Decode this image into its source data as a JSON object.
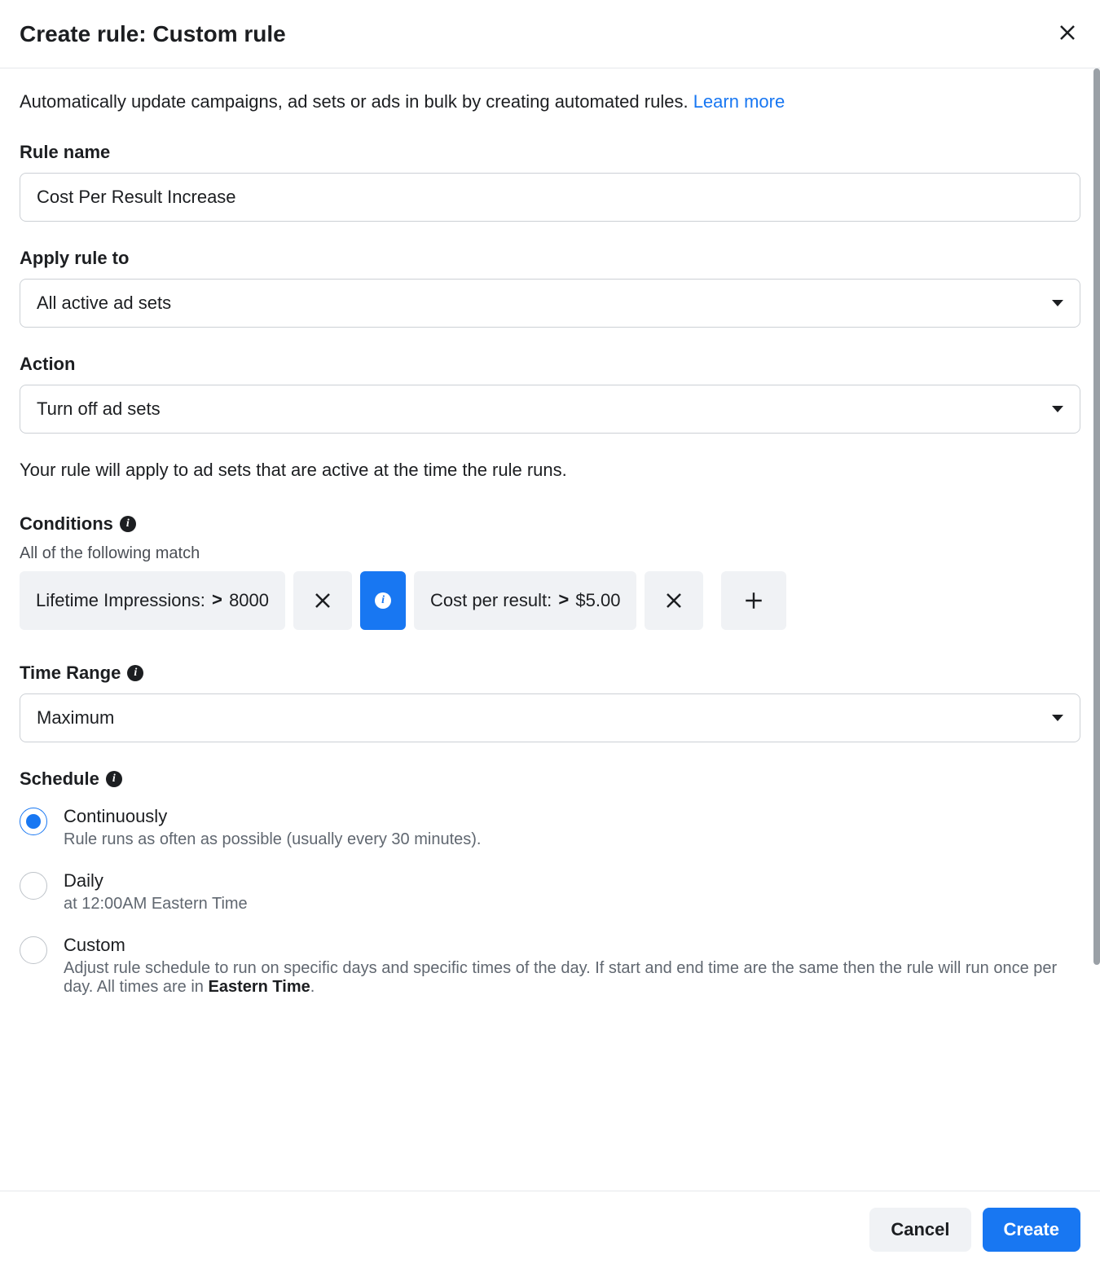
{
  "header": {
    "title": "Create rule: Custom rule"
  },
  "intro": {
    "text": "Automatically update campaigns, ad sets or ads in bulk by creating automated rules. ",
    "link": "Learn more"
  },
  "rule_name": {
    "label": "Rule name",
    "value": "Cost Per Result Increase"
  },
  "apply_to": {
    "label": "Apply rule to",
    "value": "All active ad sets"
  },
  "action": {
    "label": "Action",
    "value": "Turn off ad sets"
  },
  "note": "Your rule will apply to ad sets that are active at the time the rule runs.",
  "conditions": {
    "label": "Conditions",
    "subtext": "All of the following match",
    "items": [
      {
        "metric": "Lifetime Impressions:",
        "op": ">",
        "value": "8000",
        "has_info": true
      },
      {
        "metric": "Cost per result:",
        "op": ">",
        "value": "$5.00",
        "has_info": false
      }
    ]
  },
  "time_range": {
    "label": "Time Range",
    "value": "Maximum"
  },
  "schedule": {
    "label": "Schedule",
    "options": [
      {
        "title": "Continuously",
        "desc": "Rule runs as often as possible (usually every 30 minutes).",
        "checked": true
      },
      {
        "title": "Daily",
        "desc": "at 12:00AM Eastern Time",
        "checked": false
      },
      {
        "title": "Custom",
        "desc_pre": "Adjust rule schedule to run on specific days and specific times of the day. If start and end time are the same then the rule will run once per day. All times are in ",
        "desc_bold": "Eastern Time",
        "desc_post": ".",
        "checked": false
      }
    ]
  },
  "footer": {
    "cancel": "Cancel",
    "create": "Create"
  }
}
